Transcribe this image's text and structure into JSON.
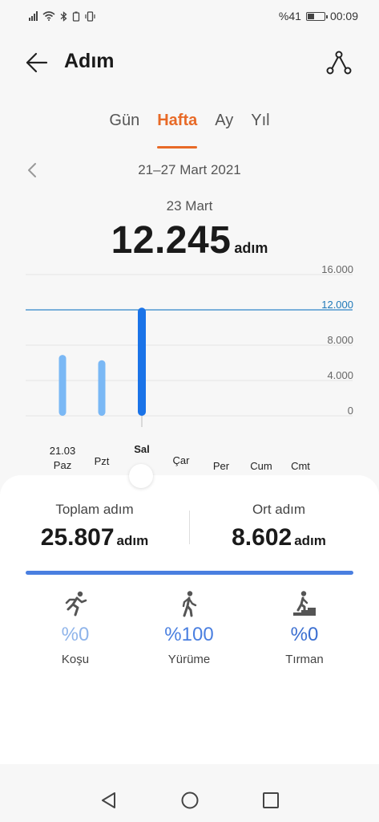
{
  "status_bar": {
    "battery_text": "%41",
    "time": "00:09",
    "battery_level": 0.41
  },
  "header": {
    "title": "Adım"
  },
  "tabs": [
    {
      "label": "Gün",
      "active": false
    },
    {
      "label": "Hafta",
      "active": true
    },
    {
      "label": "Ay",
      "active": false
    },
    {
      "label": "Yıl",
      "active": false
    }
  ],
  "period": {
    "label": "21–27 Mart 2021"
  },
  "selection": {
    "date": "23 Mart",
    "value": "12.245",
    "unit": "adım"
  },
  "chart_data": {
    "type": "bar",
    "categories": [
      "Paz",
      "Pzt",
      "Sal",
      "Çar",
      "Per",
      "Cum",
      "Cmt"
    ],
    "first_date_label": "21.03",
    "values": [
      6900,
      6300,
      12245,
      0,
      0,
      0,
      0
    ],
    "selected_index": 2,
    "y_ticks": [
      "16.000",
      "12.000",
      "8.000",
      "4.000",
      "0"
    ],
    "y_tick_values": [
      16000,
      12000,
      8000,
      4000,
      0
    ],
    "reference_value": 12000,
    "ylim": [
      0,
      16000
    ],
    "colors": {
      "bar": "#7ab8f5",
      "bar_selected": "#1a73e8",
      "reference_line": "#2f86c9",
      "reference_label": "#1f78b8"
    }
  },
  "summary": {
    "total_label": "Toplam adım",
    "total_value": "25.807",
    "total_unit": "adım",
    "avg_label": "Ort adım",
    "avg_value": "8.602",
    "avg_unit": "adım"
  },
  "activities": [
    {
      "pct": "%0",
      "label": "Koşu",
      "icon": "running-icon",
      "color": "#8fb4ea"
    },
    {
      "pct": "%100",
      "label": "Yürüme",
      "icon": "walking-icon",
      "color": "#4a7fe0"
    },
    {
      "pct": "%0",
      "label": "Tırman",
      "icon": "stairs-climbing-icon",
      "color": "#3b6fd1"
    }
  ],
  "progress_fill": 1.0
}
